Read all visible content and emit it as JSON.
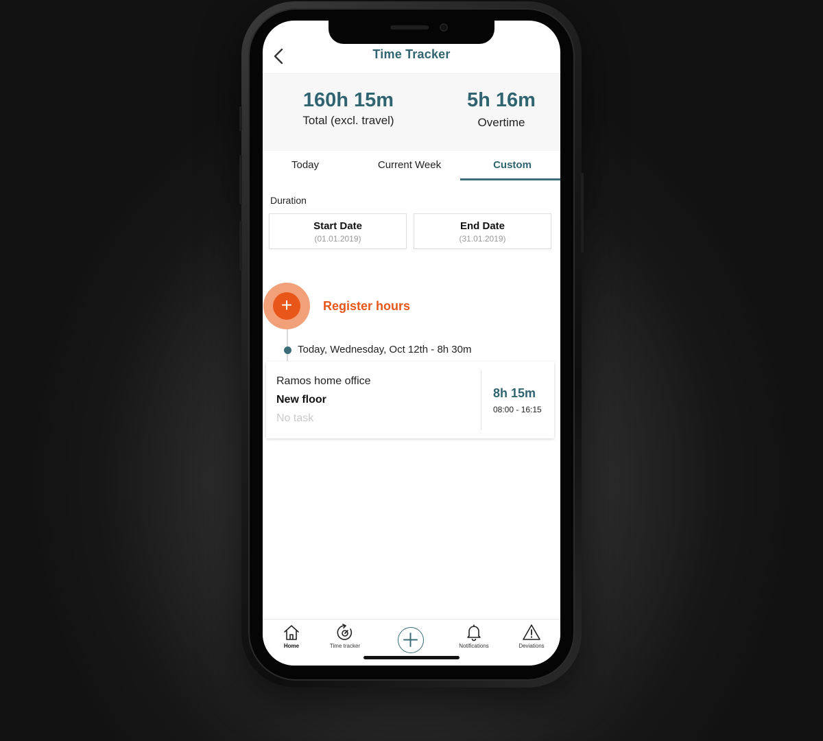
{
  "header": {
    "title": "Time Tracker"
  },
  "summary": {
    "total_value": "160h 15m",
    "total_label": "Total (excl. travel)",
    "overtime_value": "5h 16m",
    "overtime_label": "Overtime"
  },
  "tabs": [
    {
      "label": "Today"
    },
    {
      "label": "Current Week"
    },
    {
      "label": "Custom",
      "active": true
    }
  ],
  "duration": {
    "label": "Duration",
    "start_title": "Start Date",
    "start_value": "(01.01.2019)",
    "end_title": "End Date",
    "end_value": "(31.01.2019)"
  },
  "register": {
    "label": "Register hours",
    "button_glyph": "+"
  },
  "timeline": {
    "day_label": "Today, Wednesday, Oct 12th - 8h 30m"
  },
  "entry": {
    "project": "Ramos home office",
    "task_name": "New floor",
    "task": "No task",
    "duration": "8h 15m",
    "range": "08:00 - 16:15"
  },
  "nav": [
    {
      "label": "Home",
      "icon": "home-icon",
      "active": true
    },
    {
      "label": "Time tracker",
      "icon": "time-tracker-icon"
    },
    {
      "label": "",
      "icon": "plus-icon"
    },
    {
      "label": "Notifications",
      "icon": "bell-icon"
    },
    {
      "label": "Deviations",
      "icon": "warning-icon"
    }
  ],
  "colors": {
    "primary": "#2f6470",
    "accent": "#e8561a",
    "accent_halo": "#f2a07a",
    "tab_underline": "#3b6c77"
  }
}
